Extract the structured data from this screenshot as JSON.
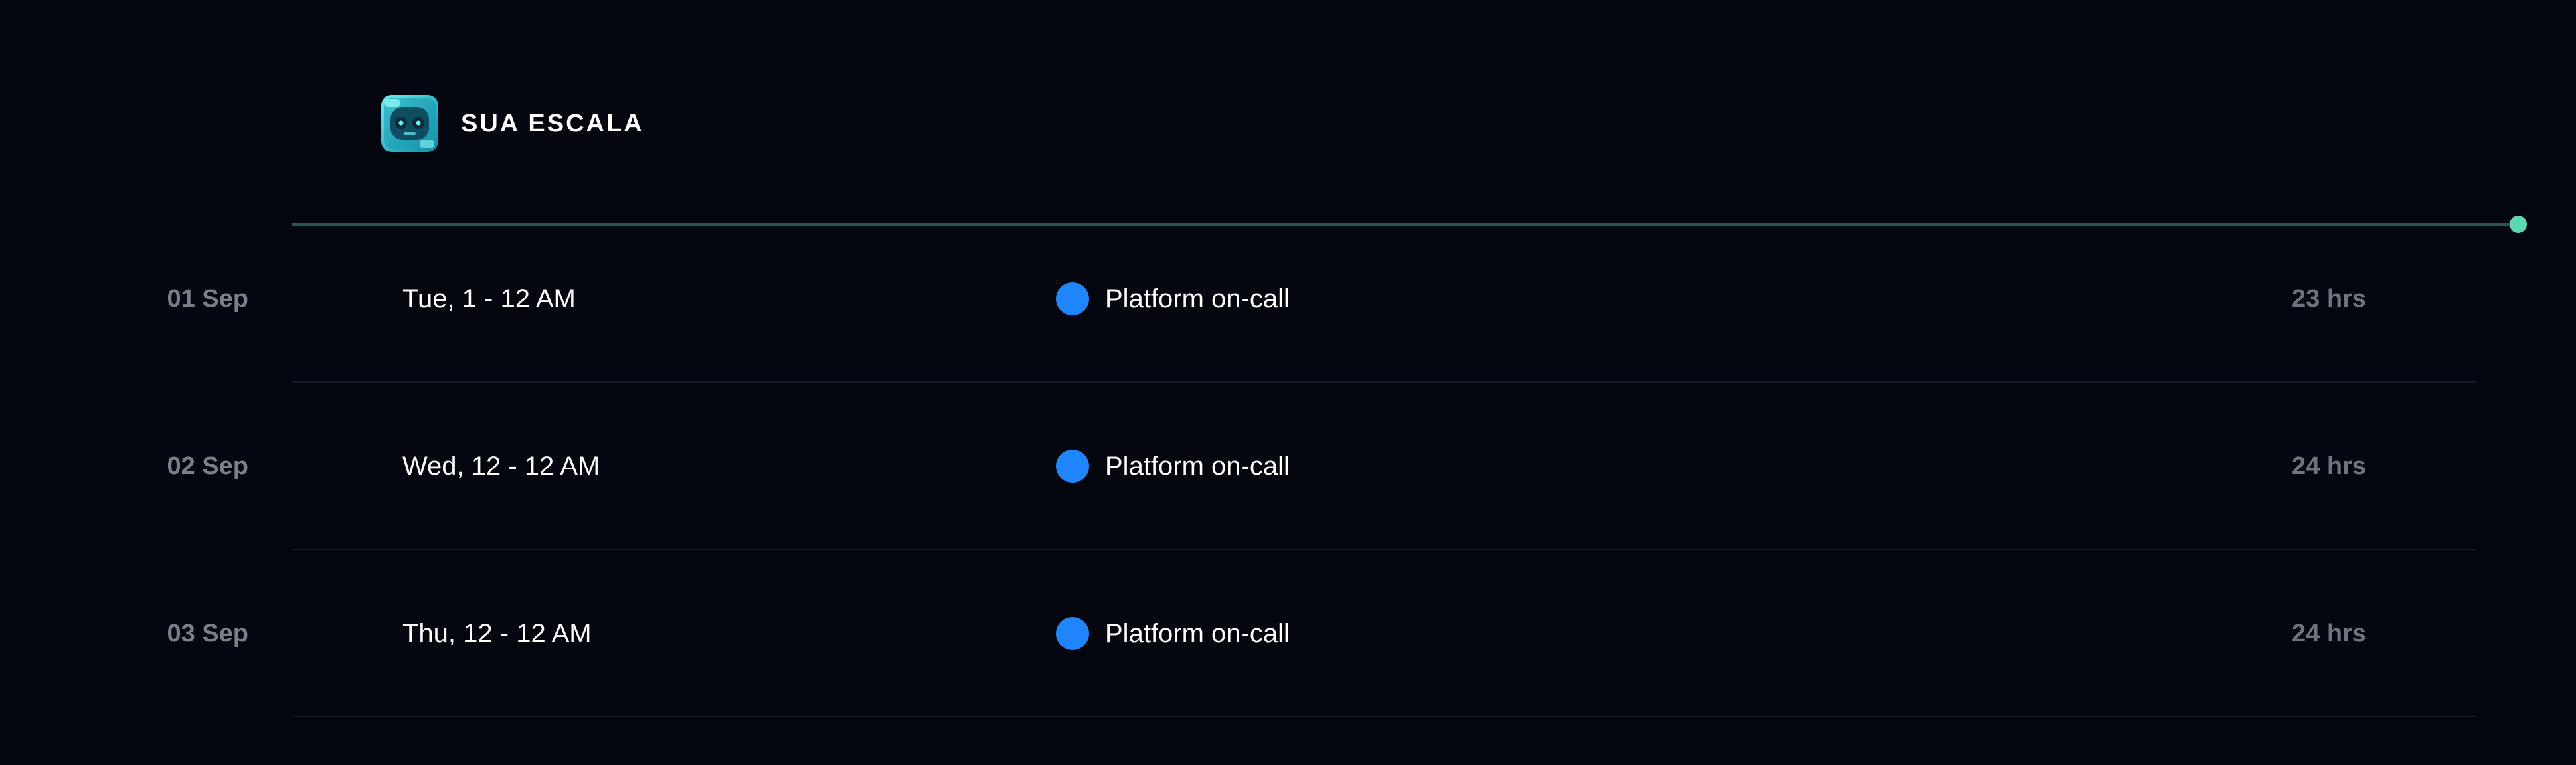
{
  "header": {
    "title": "SUA ESCALA",
    "avatar_icon": "robot-avatar-icon"
  },
  "colors": {
    "background": "#03060f",
    "timeline": "#24574f",
    "timeline_dot": "#5cd6b3",
    "shift_dot": "#1f86ff",
    "muted_text": "#7b7f8a"
  },
  "schedule": [
    {
      "date": "01 Sep",
      "time": "Tue, 1 - 12 AM",
      "shift": "Platform on-call",
      "hours": "23 hrs"
    },
    {
      "date": "02 Sep",
      "time": "Wed, 12 - 12 AM",
      "shift": "Platform on-call",
      "hours": "24 hrs"
    },
    {
      "date": "03 Sep",
      "time": "Thu, 12 - 12 AM",
      "shift": "Platform on-call",
      "hours": "24 hrs"
    }
  ]
}
